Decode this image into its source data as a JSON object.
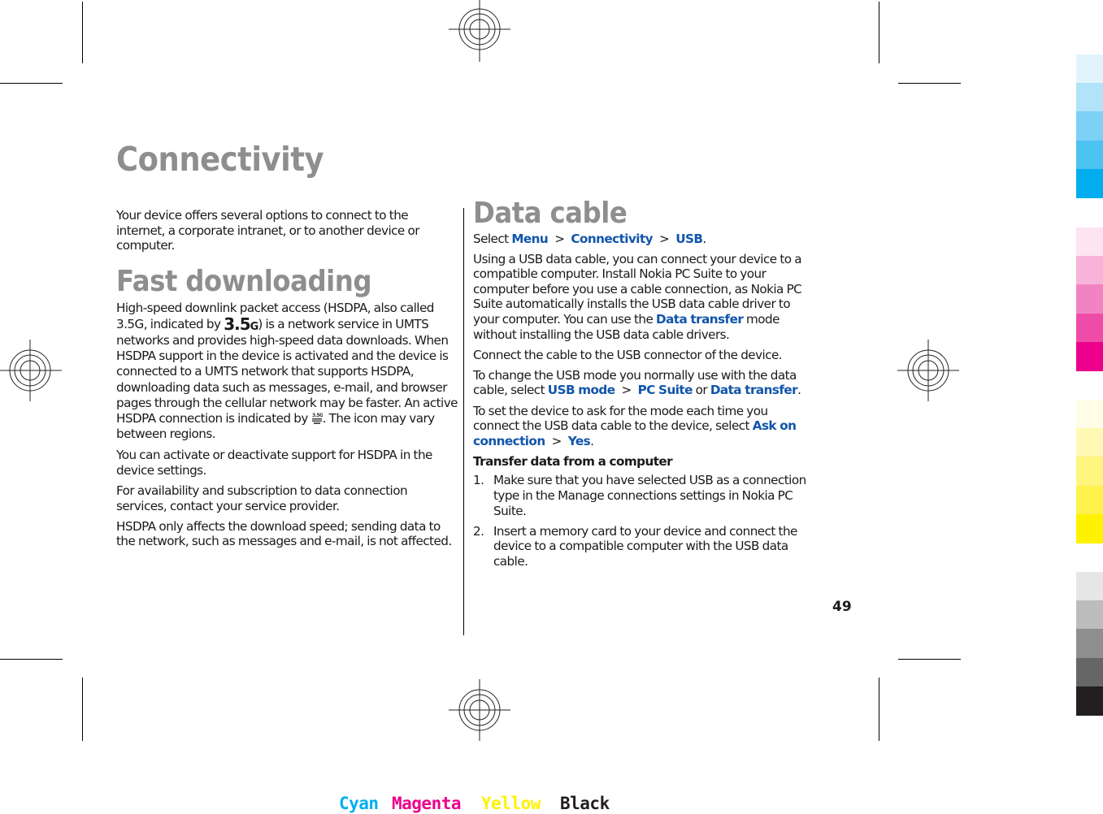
{
  "page": {
    "title": "Connectivity",
    "intro": "Your device offers several options to connect to the internet, a corporate intranet, or to another device or computer.",
    "page_number": "49"
  },
  "fast_downloading": {
    "heading": "Fast downloading",
    "p1_before_icon": "High-speed downlink packet access (HSDPA, also called 3.5G, indicated by ",
    "icon_35g_main": "3.5",
    "icon_35g_sub": "G",
    "p1_mid": ") is a network service in UMTS networks and provides high-speed data downloads. When HSDPA support in the device is activated and the device is connected to a UMTS network that supports HSDPA, downloading data such as messages, e-mail, and browser pages through the cellular network may be faster. An active HSDPA connection is indicated by ",
    "p1_end": ". The icon may vary between regions.",
    "p2": "You can activate or deactivate support for HSDPA in the device settings.",
    "p3": "For availability and subscription to data connection services, contact your service provider.",
    "p4": "HSDPA only affects the download speed; sending data to the network, such as messages and e-mail, is not affected.",
    "icons": [
      "3.5g-indicator-icon",
      "hsdpa-active-icon"
    ]
  },
  "data_cable": {
    "heading": "Data cable",
    "select_prefix": "Select ",
    "path": [
      "Menu",
      "Connectivity",
      "USB"
    ],
    "path_separator": ">",
    "period": ".",
    "p1_before": "Using a USB data cable, you can connect your device to a compatible computer. Install Nokia PC Suite to your computer before you use a cable connection, as Nokia PC Suite automatically installs the USB data cable driver to your computer. You can use the ",
    "p1_link": "Data transfer",
    "p1_after": " mode without installing the USB data cable drivers.",
    "p2": "Connect the cable to the USB connector of the device.",
    "p3_before": "To change the USB mode you normally use with the data cable, select ",
    "p3_link1": "USB mode",
    "p3_link2": "PC Suite",
    "p3_or": " or ",
    "p3_link3": "Data transfer",
    "p4_before": "To set the device to ask for the mode each time you connect the USB data cable to the device, select ",
    "p4_link1": "Ask on connection",
    "p4_link2": "Yes",
    "subheading": "Transfer data from a computer",
    "steps": [
      {
        "num": "1.",
        "text": "Make sure that you have selected USB as a connection type in the Manage connections settings in Nokia PC Suite."
      },
      {
        "num": "2.",
        "text": "Insert a memory card to your device and connect the device to a compatible computer with the USB data cable."
      }
    ]
  },
  "print_marks": {
    "color_bar": {
      "cyan": [
        "#e1f4fc",
        "#b1e3f9",
        "#7dd1f5",
        "#4cc3f1",
        "#00aeef"
      ],
      "magenta": [
        "#fce4f1",
        "#f8b3da",
        "#f283c3",
        "#ee4ca8",
        "#ec008c"
      ],
      "yellow": [
        "#fffde5",
        "#fff9b3",
        "#fff57f",
        "#fff24c",
        "#fff200"
      ],
      "black": [
        "#e6e6e6",
        "#bcbcbc",
        "#8e8e8e",
        "#666666",
        "#231f20"
      ]
    },
    "labels": [
      {
        "text": "Cyan",
        "color": "#00aeef"
      },
      {
        "text": "Magenta",
        "color": "#ec008c"
      },
      {
        "text": "Yellow",
        "color": "#fff200"
      },
      {
        "text": "Black",
        "color": "#231f20"
      }
    ]
  }
}
